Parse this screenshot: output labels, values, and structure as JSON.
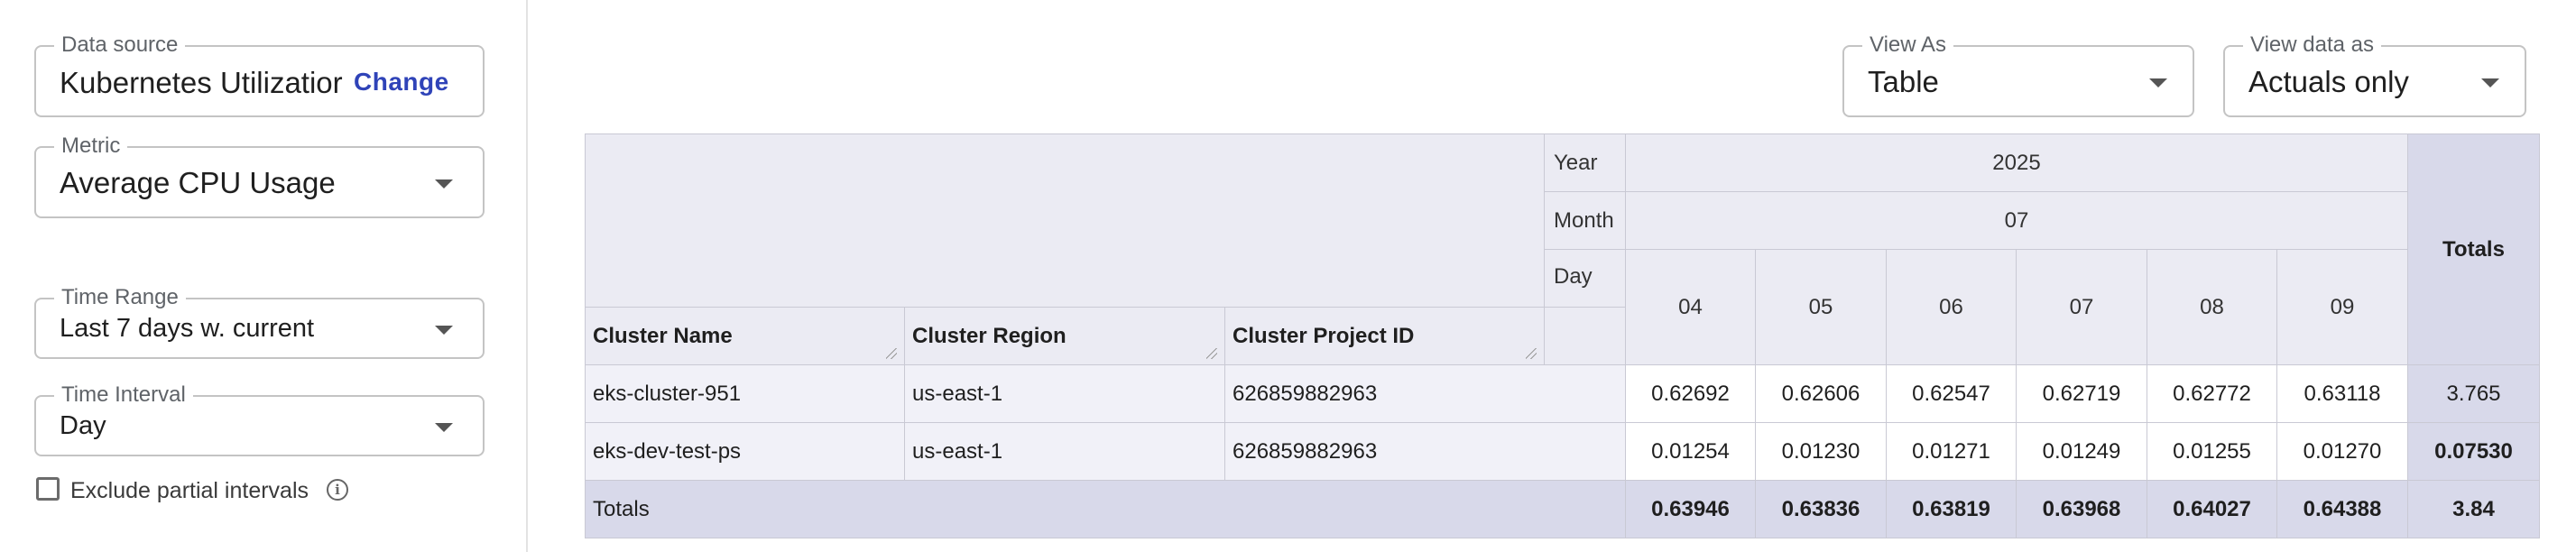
{
  "sidebar": {
    "data_source": {
      "label": "Data source",
      "value": "Kubernetes Utilizatior",
      "change_label": "Change"
    },
    "metric": {
      "label": "Metric",
      "value": "Average CPU Usage"
    },
    "time_range": {
      "label": "Time Range",
      "value": "Last 7 days w. current"
    },
    "time_interval": {
      "label": "Time Interval",
      "value": "Day"
    },
    "exclude_partial": {
      "label": "Exclude partial intervals",
      "checked": false
    }
  },
  "toolbar": {
    "view_as": {
      "label": "View As",
      "value": "Table"
    },
    "view_data_as": {
      "label": "View data as",
      "value": "Actuals only"
    }
  },
  "table": {
    "axis_labels": {
      "year": "Year",
      "month": "Month",
      "day": "Day"
    },
    "year": "2025",
    "month": "07",
    "days": [
      "04",
      "05",
      "06",
      "07",
      "08",
      "09"
    ],
    "totals_label": "Totals",
    "columns": [
      "Cluster Name",
      "Cluster Region",
      "Cluster Project ID"
    ],
    "rows": [
      {
        "cluster_name": "eks-cluster-951",
        "region": "us-east-1",
        "project_id": "626859882963",
        "values": [
          "0.62692",
          "0.62606",
          "0.62547",
          "0.62719",
          "0.62772",
          "0.63118"
        ],
        "total": "3.765"
      },
      {
        "cluster_name": "eks-dev-test-ps",
        "region": "us-east-1",
        "project_id": "626859882963",
        "values": [
          "0.01254",
          "0.01230",
          "0.01271",
          "0.01249",
          "0.01255",
          "0.01270"
        ],
        "total": "0.07530"
      }
    ],
    "totals_row": {
      "label": "Totals",
      "values": [
        "0.63946",
        "0.63836",
        "0.63819",
        "0.63968",
        "0.64027",
        "0.64388"
      ],
      "total": "3.84"
    }
  }
}
